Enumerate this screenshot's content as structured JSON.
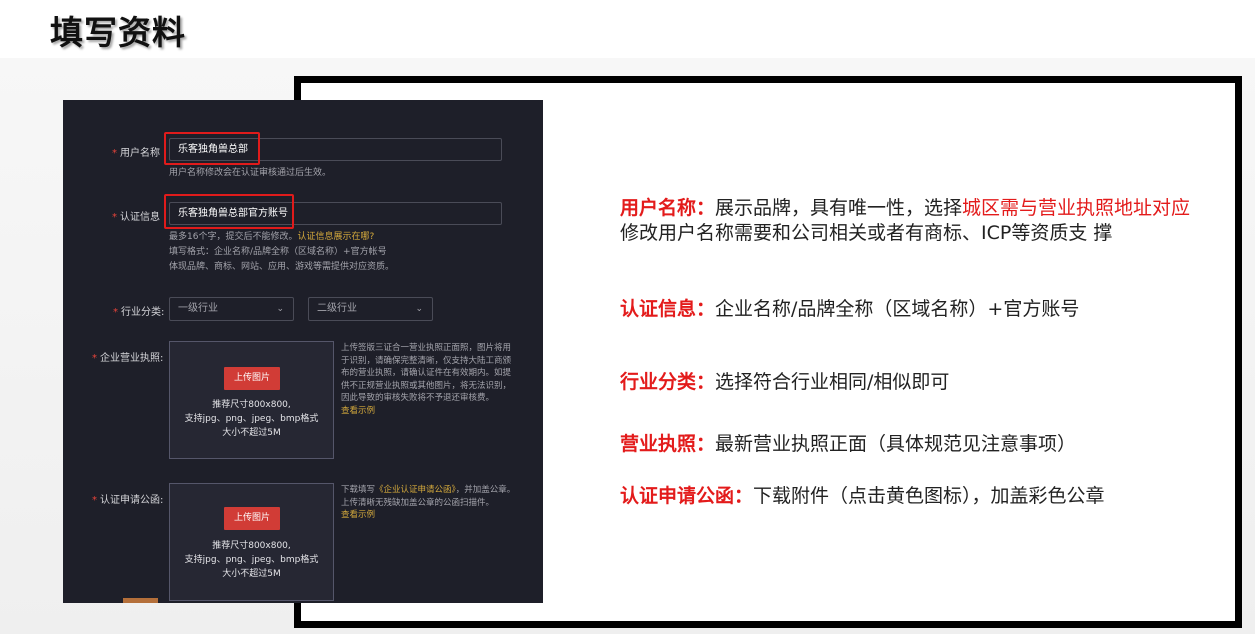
{
  "page_title": "填写资料",
  "form": {
    "username": {
      "label": "用户名称",
      "value": "乐客独角兽总部",
      "hint": "用户名称修改会在认证审核通过后生效。"
    },
    "cert_info": {
      "label": "认证信息",
      "value": "乐客独角兽总部官方账号",
      "hint_prefix": "最多16个字，提交后不能修改。",
      "hint_link": "认证信息展示在哪?",
      "hint_line2": "填写格式：企业名称/品牌全称（区域名称）+官方帐号",
      "hint_line3": "体现品牌、商标、网站、应用、游戏等需提供对应资质。"
    },
    "industry": {
      "label": "行业分类:",
      "level1_placeholder": "一级行业",
      "level2_placeholder": "二级行业"
    },
    "license": {
      "label": "企业营业执照:",
      "upload_label": "上传图片",
      "note1": "推荐尺寸800x800,",
      "note2": "支持jpg、png、jpeg、bmp格式",
      "note3": "大小不超过5M",
      "side_note": "上传签版三证合一营业执照正面照，图片将用于识别，请确保完整清晰，仅支持大陆工商颁布的营业执照，请确认证件在有效期内。如提供不正规营业执照或其他图片，将无法识别，因此导致的审核失败将不予退还审核费。",
      "side_link": "查看示例"
    },
    "letter": {
      "label": "认证申请公函:",
      "upload_label": "上传图片",
      "note1": "推荐尺寸800x800,",
      "note2": "支持jpg、png、jpeg、bmp格式",
      "note3": "大小不超过5M",
      "side_prefix": "下载填写",
      "side_doc": "《企业认证申请公函》",
      "side_suffix": "，并加盖公章。上传清晰无残缺加盖公章的公函扫描件。",
      "side_link": "查看示例"
    }
  },
  "explanations": {
    "username": {
      "key": "用户名称",
      "colon": "：",
      "text1": "展示品牌，具有唯一性，选择",
      "highlight": "城区需与营业执照地址对应",
      "text2": "修改用户名称需要和公司相关或者有商标、ICP等资质支 撑"
    },
    "cert_info": {
      "key": "认证信息",
      "colon": "：",
      "text": "企业名称/品牌全称（区域名称）+官方账号"
    },
    "industry": {
      "key": "行业分类",
      "colon": "：",
      "text": "选择符合行业相同/相似即可"
    },
    "license": {
      "key": "营业执照",
      "colon": "：",
      "text": "最新营业执照正面（具体规范见注意事项）"
    },
    "letter": {
      "key": "认证申请公函",
      "colon": "：",
      "text": "下载附件（点击黄色图标），加盖彩色公章"
    }
  },
  "colors": {
    "accent_red": "#e31b1b",
    "panel_bg": "#1e1f29",
    "link_gold": "#d4a93c",
    "upload_button": "#d13c36"
  }
}
